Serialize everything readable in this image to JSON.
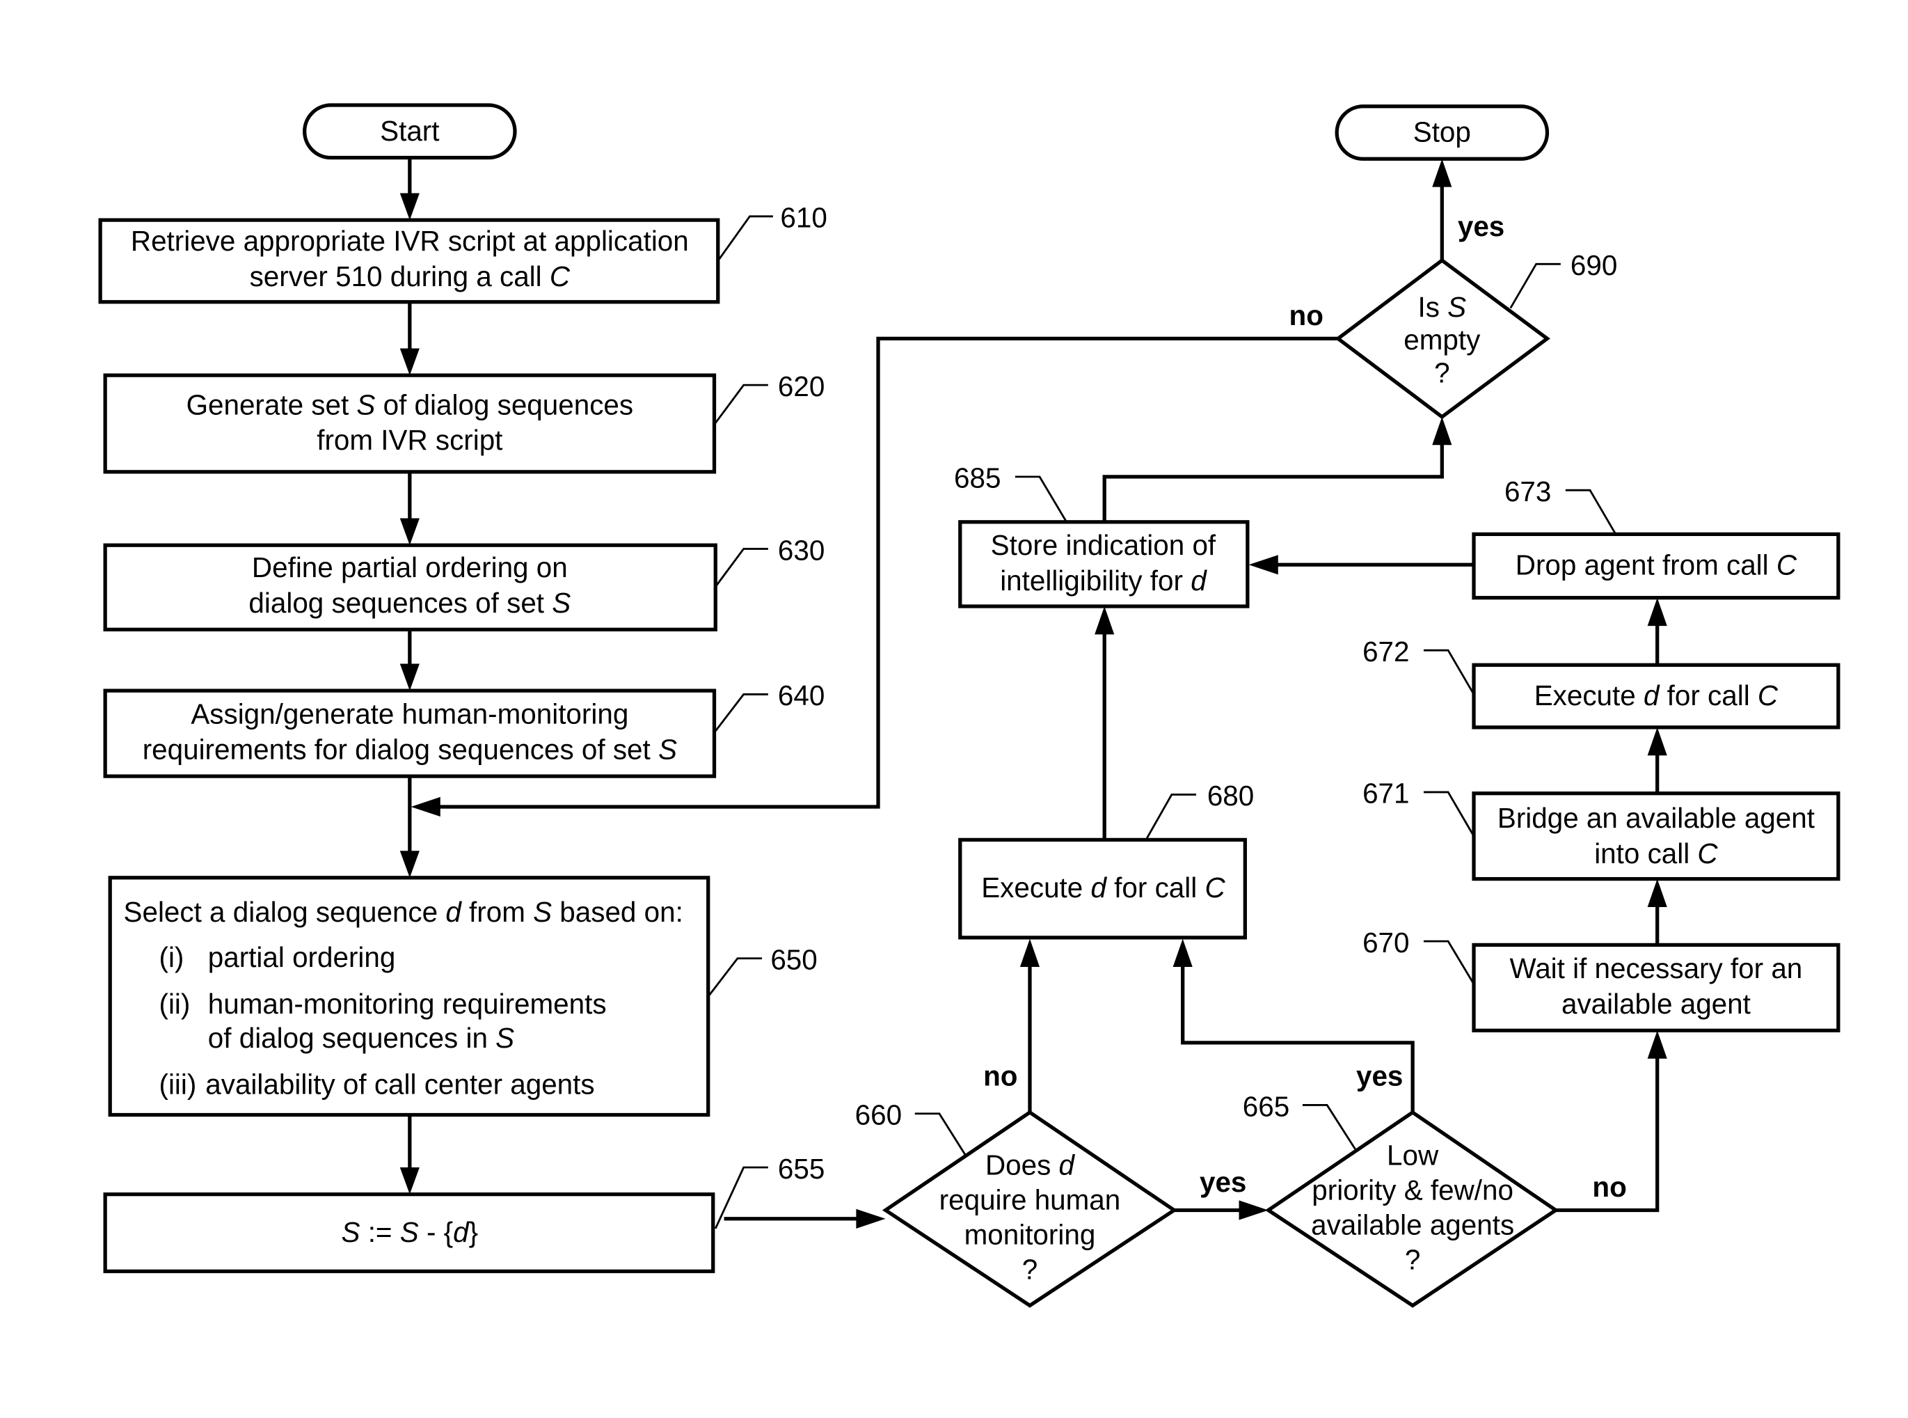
{
  "diagram": {
    "type": "flowchart",
    "terminals": {
      "start": "Start",
      "stop": "Stop"
    },
    "nodes": {
      "n610": {
        "ref": "610",
        "lines": [
          [
            "Retrieve appropriate IVR script at application"
          ],
          [
            "server 510 during a call ",
            {
              "i": "C"
            }
          ]
        ]
      },
      "n620": {
        "ref": "620",
        "lines": [
          [
            "Generate set ",
            {
              "i": "S"
            },
            " of dialog sequences"
          ],
          [
            "from IVR script"
          ]
        ]
      },
      "n630": {
        "ref": "630",
        "lines": [
          [
            "Define partial ordering on"
          ],
          [
            "dialog sequences of set ",
            {
              "i": "S"
            }
          ]
        ]
      },
      "n640": {
        "ref": "640",
        "lines": [
          [
            "Assign/generate human-monitoring"
          ],
          [
            "requirements for dialog sequences of set ",
            {
              "i": "S"
            }
          ]
        ]
      },
      "n650": {
        "ref": "650",
        "heading": [
          "Select a dialog sequence ",
          {
            "i": "d"
          },
          " from ",
          {
            "i": "S"
          },
          " based on:"
        ],
        "items": [
          {
            "num": "(i)",
            "lines": [
              [
                "partial ordering"
              ]
            ]
          },
          {
            "num": "(ii)",
            "lines": [
              [
                "human-monitoring requirements"
              ],
              [
                "of dialog sequences in ",
                {
                  "i": "S"
                }
              ]
            ]
          },
          {
            "num": "(iii)",
            "lines": [
              [
                "availability of call center agents"
              ]
            ]
          }
        ]
      },
      "n655": {
        "ref": "655",
        "lines": [
          [
            {
              "i": "S"
            },
            "  :=  ",
            {
              "i": "S"
            },
            " - {",
            {
              "i": "d"
            },
            "}"
          ]
        ]
      },
      "n660": {
        "ref": "660",
        "lines": [
          [
            "Does ",
            {
              "i": "d"
            }
          ],
          [
            "require human"
          ],
          [
            "monitoring"
          ],
          [
            "?"
          ]
        ]
      },
      "n665": {
        "ref": "665",
        "lines": [
          [
            "Low"
          ],
          [
            "priority & few/no"
          ],
          [
            "available agents"
          ],
          [
            "?"
          ]
        ]
      },
      "n670": {
        "ref": "670",
        "lines": [
          [
            "Wait if necessary for an"
          ],
          [
            "available agent"
          ]
        ]
      },
      "n671": {
        "ref": "671",
        "lines": [
          [
            "Bridge an available agent"
          ],
          [
            "into call ",
            {
              "i": "C"
            }
          ]
        ]
      },
      "n672": {
        "ref": "672",
        "lines": [
          [
            "Execute ",
            {
              "i": "d"
            },
            " for call ",
            {
              "i": "C"
            }
          ]
        ]
      },
      "n673": {
        "ref": "673",
        "lines": [
          [
            "Drop agent from call ",
            {
              "i": "C"
            }
          ]
        ]
      },
      "n680": {
        "ref": "680",
        "lines": [
          [
            "Execute ",
            {
              "i": "d"
            },
            " for call ",
            {
              "i": "C"
            }
          ]
        ]
      },
      "n685": {
        "ref": "685",
        "lines": [
          [
            "Store indication of"
          ],
          [
            "intelligibility for ",
            {
              "i": "d"
            }
          ]
        ]
      },
      "n690": {
        "ref": "690",
        "lines": [
          [
            "Is ",
            {
              "i": "S"
            }
          ],
          [
            "empty"
          ],
          [
            "?"
          ]
        ]
      }
    },
    "edge_labels": {
      "n660_no": "no",
      "n660_yes": "yes",
      "n665_yes": "yes",
      "n665_no": "no",
      "n690_yes": "yes",
      "n690_no": "no"
    }
  }
}
